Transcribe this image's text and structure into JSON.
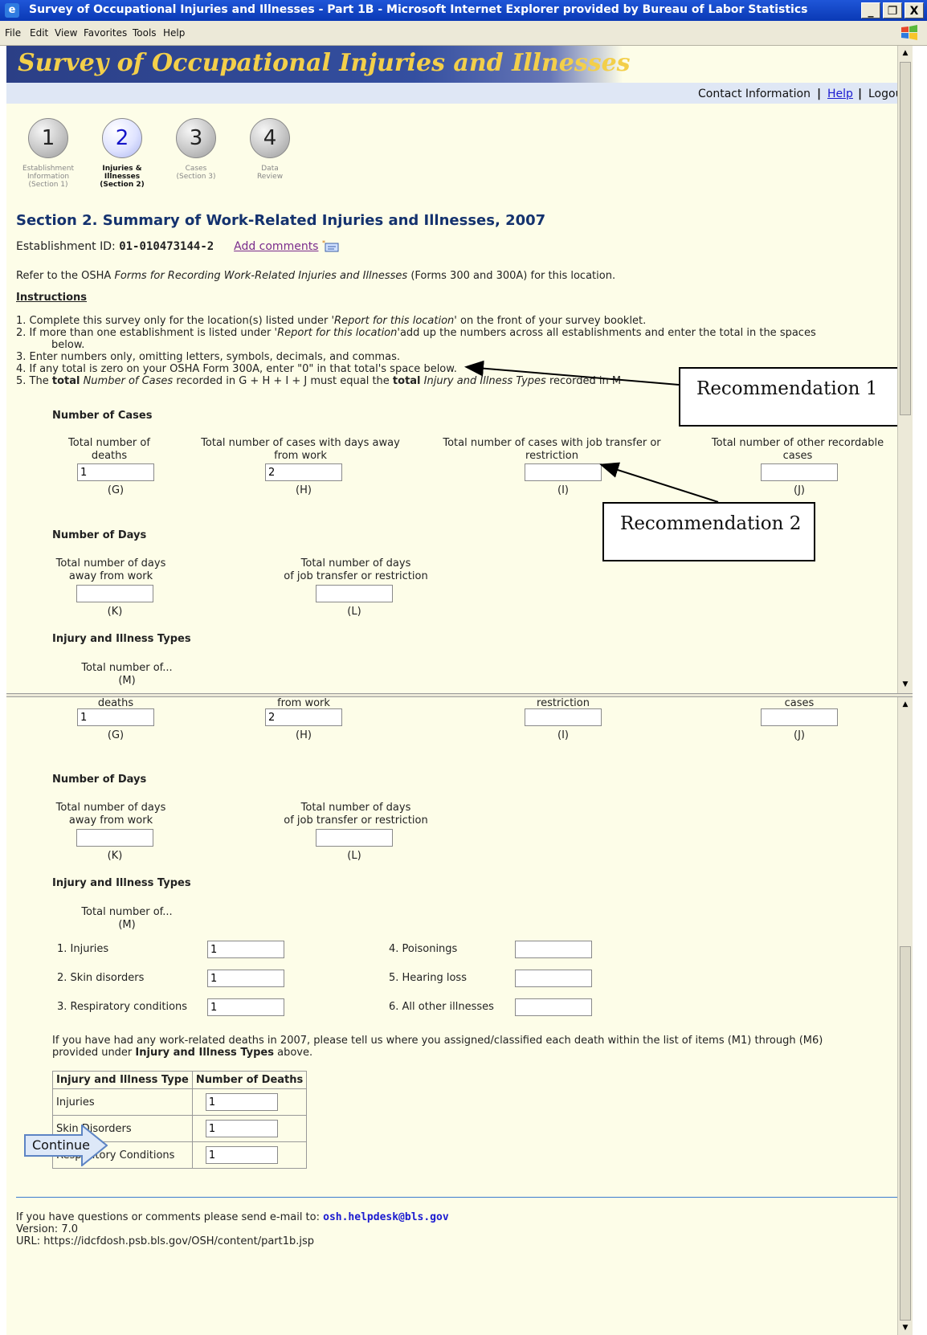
{
  "window": {
    "title": "Survey of Occupational Injuries and Illnesses - Part 1B - Microsoft Internet Explorer provided by Bureau of Labor Statistics",
    "minimize": "_",
    "restore": "Ὕ7",
    "close": "X"
  },
  "menu": [
    "File",
    "Edit",
    "View",
    "Favorites",
    "Tools",
    "Help"
  ],
  "banner": {
    "title": "Survey of Occupational Injuries and Illnesses"
  },
  "toplinks": {
    "contact": "Contact Information",
    "sep1": "|",
    "help": "Help",
    "sep2": "|",
    "logout": "Logout"
  },
  "steps": [
    {
      "num": "1",
      "label1": "Establishment",
      "label2": "Information",
      "label3": "(Section 1)"
    },
    {
      "num": "2",
      "label1": "Injuries &",
      "label2": "Illnesses",
      "label3": "(Section 2)"
    },
    {
      "num": "3",
      "label1": "Cases",
      "label2": "(Section 3)",
      "label3": ""
    },
    {
      "num": "4",
      "label1": "Data",
      "label2": "Review",
      "label3": ""
    }
  ],
  "section": {
    "title": "Section 2. Summary of Work-Related Injuries and Illnesses, 2007",
    "establishment_label": "Establishment ID:",
    "establishment_id": "01-010473144-2",
    "add_comments": "Add comments",
    "refer_pre": "Refer to the OSHA ",
    "refer_italic": "Forms for Recording Work-Related Injuries and Illnesses",
    "refer_post": " (Forms 300 and 300A) for this location.",
    "instructions_heading": "Instructions"
  },
  "instructions": {
    "i1_a": "1.  Complete this survey only for the location(s) listed under ",
    "i1_b": "'Report for this location'",
    "i1_c": " on the front of your survey booklet.",
    "i2_a": "2.  If more than one establishment is listed under ",
    "i2_b": "'Report for this location'",
    "i2_c": "add up the numbers across all establishments and enter the total in the spaces",
    "i2_d": "below.",
    "i3": "3.  Enter numbers only, omitting letters, symbols, decimals, and commas.",
    "i4": "4.  If any total is zero on your OSHA Form 300A, enter \"0\" in that total's space below.",
    "i5_a": "5.  The ",
    "i5_b": "total",
    "i5_c": " Number of Cases",
    "i5_d": " recorded in G + H + I + J must equal the ",
    "i5_e": "total",
    "i5_f": " Injury and Illness Types",
    "i5_g": " recorded in M"
  },
  "cases": {
    "heading": "Number of Cases",
    "g_label1": "Total number of",
    "g_label2": "deaths",
    "g_value": "1",
    "g_code": "(G)",
    "h_label1": "Total number of cases with days away",
    "h_label2": "from work",
    "h_value": "2",
    "h_code": "(H)",
    "i_label1": "Total number of cases with job transfer or",
    "i_label2": "restriction",
    "i_value": "",
    "i_code": "(I)",
    "j_label1": "Total number of other recordable",
    "j_label2": "cases",
    "j_value": "",
    "j_code": "(J)"
  },
  "days": {
    "heading": "Number of Days",
    "k_label1": "Total number of days",
    "k_label2": "away from work",
    "k_value": "",
    "k_code": "(K)",
    "l_label1": "Total number of days",
    "l_label2": "of job transfer or restriction",
    "l_value": "",
    "l_code": "(L)"
  },
  "types": {
    "heading": "Injury and Illness Types",
    "m_label": "Total number of...",
    "m_code": "(M)",
    "m1_label": "1. Injuries",
    "m1_value": "1",
    "m2_label": "2. Skin disorders",
    "m2_value": "1",
    "m3_label": "3. Respiratory conditions",
    "m3_value": "1",
    "m4_label": "4. Poisonings",
    "m4_value": "",
    "m5_label": "5. Hearing loss",
    "m5_value": "",
    "m6_label": "6. All other illnesses",
    "m6_value": ""
  },
  "deaths_question": {
    "line1": "If you have had any work-related deaths in 2007, please tell us where you assigned/classified each death within the list of items (M1) through (M6)",
    "line2_a": "provided under ",
    "line2_b": "Injury and Illness Types",
    "line2_c": " above."
  },
  "death_table": {
    "col1": "Injury and Illness Type",
    "col2": "Number of Deaths",
    "rows": [
      {
        "type": "Injuries",
        "value": "1"
      },
      {
        "type": "Skin Disorders",
        "value": "1"
      },
      {
        "type": "Respiratory Conditions",
        "value": "1"
      }
    ]
  },
  "continue_label": "Continue",
  "footer": {
    "question": "If you have questions or comments please send e-mail to: ",
    "email": "osh.helpdesk@bls.gov",
    "version": "Version: 7.0",
    "url": "URL: https://idcfdosh.psb.bls.gov/OSH/content/part1b.jsp"
  },
  "annotations": {
    "rec1": "Recommendation 1",
    "rec2": "Recommendation 2"
  }
}
